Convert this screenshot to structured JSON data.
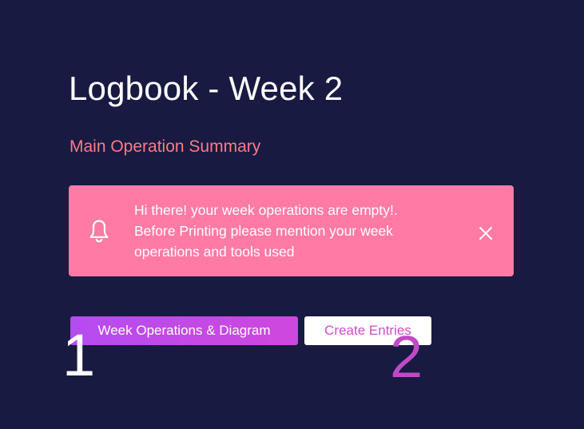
{
  "page": {
    "title": "Logbook - Week 2",
    "subtitle": "Main Operation Summary"
  },
  "alert": {
    "lines": [
      "Hi there! your week operations are empty!.",
      "Before Printing please mention your week",
      "operations and tools used"
    ],
    "icon": "bell-icon",
    "close_icon": "close-icon"
  },
  "tabs": [
    {
      "label": "Week Operations & Diagram"
    },
    {
      "label": "Create Entries"
    }
  ],
  "annotations": [
    {
      "label": "1",
      "color": "#ffffff"
    },
    {
      "label": "2",
      "color": "#bf4ac8"
    }
  ],
  "colors": {
    "background": "#181a42",
    "accent": "#ff7a86",
    "alert": "#ff7aa5",
    "tab_gradient_start": "#b54cf0",
    "tab_gradient_end": "#cf47dd",
    "secondary_tab_text": "#cc4fc8"
  }
}
